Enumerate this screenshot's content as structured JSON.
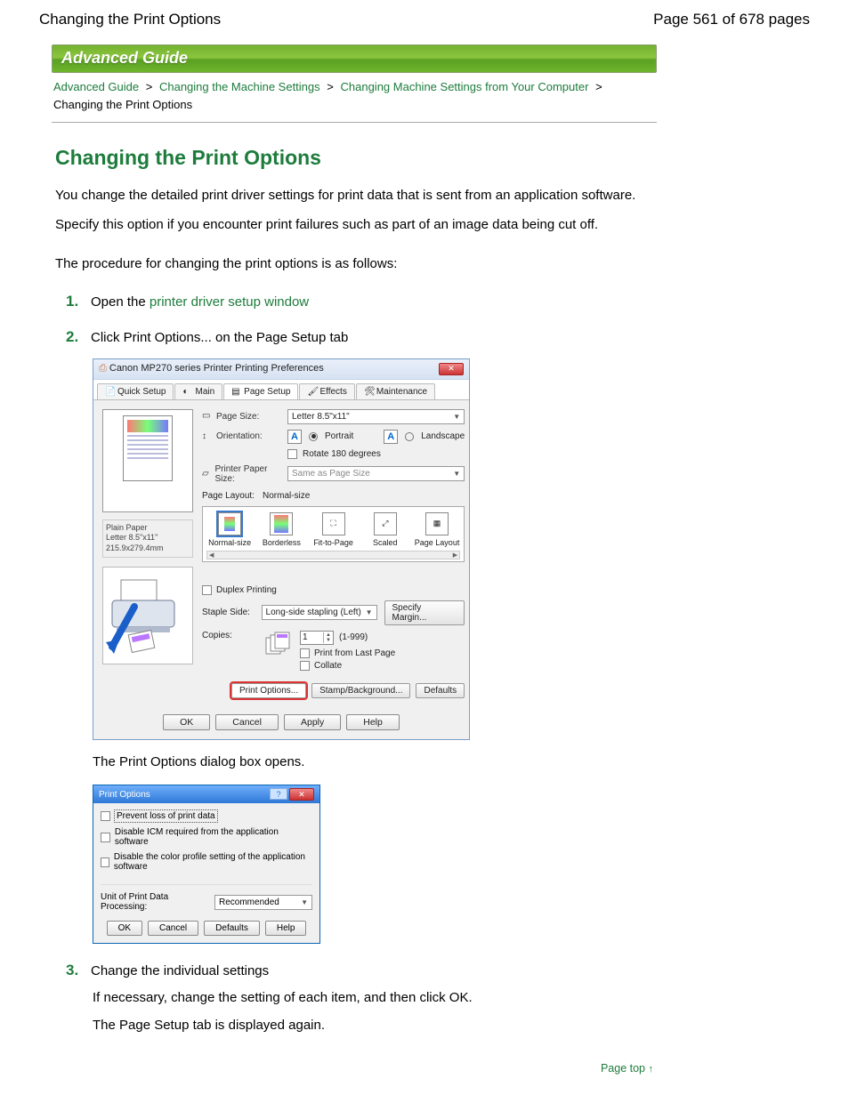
{
  "header": {
    "title": "Changing the Print Options",
    "page_info": "Page 561 of 678 pages"
  },
  "banner": {
    "label": "Advanced Guide"
  },
  "breadcrumb": {
    "items": [
      "Advanced Guide",
      "Changing the Machine Settings",
      "Changing Machine Settings from Your Computer"
    ],
    "current": "Changing the Print Options",
    "sep": ">"
  },
  "h1": "Changing the Print Options",
  "intro": {
    "p1": "You change the detailed print driver settings for print data that is sent from an application software.",
    "p2": "Specify this option if you encounter print failures such as part of an image data being cut off.",
    "p3": "The procedure for changing the print options is as follows:"
  },
  "steps": {
    "s1": {
      "num": "1.",
      "prefix": "Open the ",
      "link": "printer driver setup window"
    },
    "s2": {
      "num": "2.",
      "text": "Click Print Options... on the Page Setup tab",
      "after": "The Print Options dialog box opens."
    },
    "s3": {
      "num": "3.",
      "text": "Change the individual settings",
      "sub1": "If necessary, change the setting of each item, and then click OK.",
      "sub2": "The Page Setup tab is displayed again."
    }
  },
  "dlg1": {
    "title": "Canon MP270 series Printer Printing Preferences",
    "tabs": [
      "Quick Setup",
      "Main",
      "Page Setup",
      "Effects",
      "Maintenance"
    ],
    "active_tab_index": 2,
    "preview_meta1": "Plain Paper",
    "preview_meta2": "Letter 8.5\"x11\" 215.9x279.4mm",
    "fields": {
      "page_size_label": "Page Size:",
      "page_size_value": "Letter 8.5\"x11\"",
      "orient_label": "Orientation:",
      "orient_portrait": "Portrait",
      "orient_landscape": "Landscape",
      "rotate_label": "Rotate 180 degrees",
      "printer_paper_label": "Printer Paper Size:",
      "printer_paper_value": "Same as Page Size",
      "page_layout_label": "Page Layout:",
      "page_layout_value": "Normal-size"
    },
    "layouts": [
      "Normal-size",
      "Borderless",
      "Fit-to-Page",
      "Scaled",
      "Page Layout"
    ],
    "duplex": {
      "label": "Duplex Printing",
      "staple_label": "Staple Side:",
      "staple_value": "Long-side stapling (Left)",
      "margin_btn": "Specify Margin..."
    },
    "copies": {
      "label": "Copies:",
      "value": "1",
      "range": "(1-999)",
      "chk1": "Print from Last Page",
      "chk2": "Collate"
    },
    "lower_buttons": {
      "print_options": "Print Options...",
      "stamp": "Stamp/Background...",
      "defaults": "Defaults"
    },
    "footer": {
      "ok": "OK",
      "cancel": "Cancel",
      "apply": "Apply",
      "help": "Help"
    }
  },
  "dlg2": {
    "title": "Print Options",
    "chk1": "Prevent loss of print data",
    "chk2": "Disable ICM required from the application software",
    "chk3": "Disable the color profile setting of the application software",
    "unit_label": "Unit of Print Data Processing:",
    "unit_value": "Recommended",
    "footer": {
      "ok": "OK",
      "cancel": "Cancel",
      "defaults": "Defaults",
      "help": "Help"
    }
  },
  "page_top": {
    "label": "Page top"
  }
}
